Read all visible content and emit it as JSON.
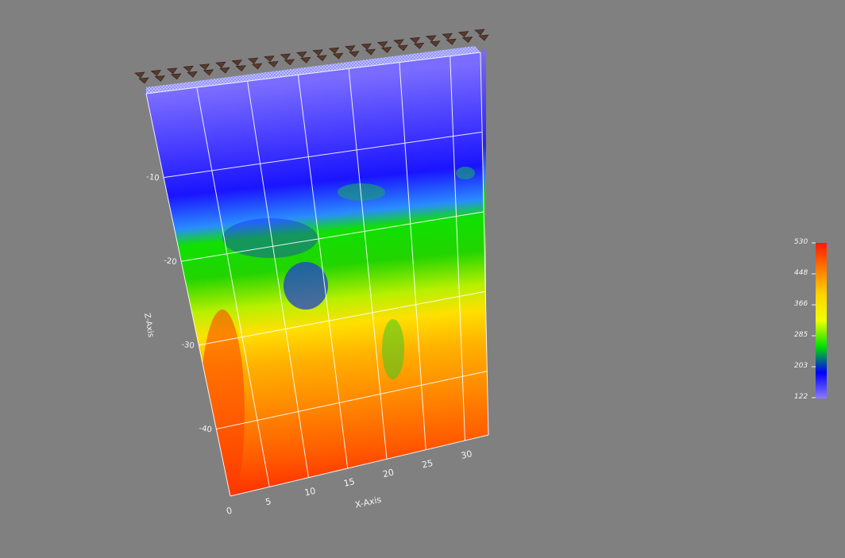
{
  "chart_data": {
    "type": "heatmap",
    "title": "",
    "xlabel": "X-Axis",
    "ylabel": "Z-Axis",
    "x_ticks": [
      "0",
      "5",
      "10",
      "15",
      "20",
      "25",
      "30"
    ],
    "z_ticks": [
      "-10",
      "-20",
      "-30",
      "-40"
    ],
    "xlim": [
      0,
      33
    ],
    "zlim": [
      -48,
      0
    ],
    "colorbar": {
      "labels": [
        "530",
        "448",
        "366",
        "285",
        "203",
        "122"
      ],
      "min": 122,
      "max": 530,
      "colors": [
        "#ff1a00",
        "#ff7a00",
        "#ffd400",
        "#f0ff00",
        "#00e000",
        "#0000ff",
        "#8a7aff"
      ]
    },
    "colors": {
      "background": "#808080",
      "grid": "#ffffff",
      "marker": "#5a3a2e"
    },
    "bands": [
      {
        "depth": 0,
        "color": "#7a6cff"
      },
      {
        "depth": 6,
        "color": "#4b40ff"
      },
      {
        "depth": 12,
        "color": "#1a14ff"
      },
      {
        "depth": 16,
        "color": "#2a8cff"
      },
      {
        "depth": 18,
        "color": "#10e000"
      },
      {
        "depth": 22,
        "color": "#22d400"
      },
      {
        "depth": 26,
        "color": "#b8f000"
      },
      {
        "depth": 29,
        "color": "#ffe000"
      },
      {
        "depth": 33,
        "color": "#ffb000"
      },
      {
        "depth": 38,
        "color": "#ff8a00"
      },
      {
        "depth": 44,
        "color": "#ff5a00"
      },
      {
        "depth": 48,
        "color": "#ff3000"
      }
    ]
  }
}
